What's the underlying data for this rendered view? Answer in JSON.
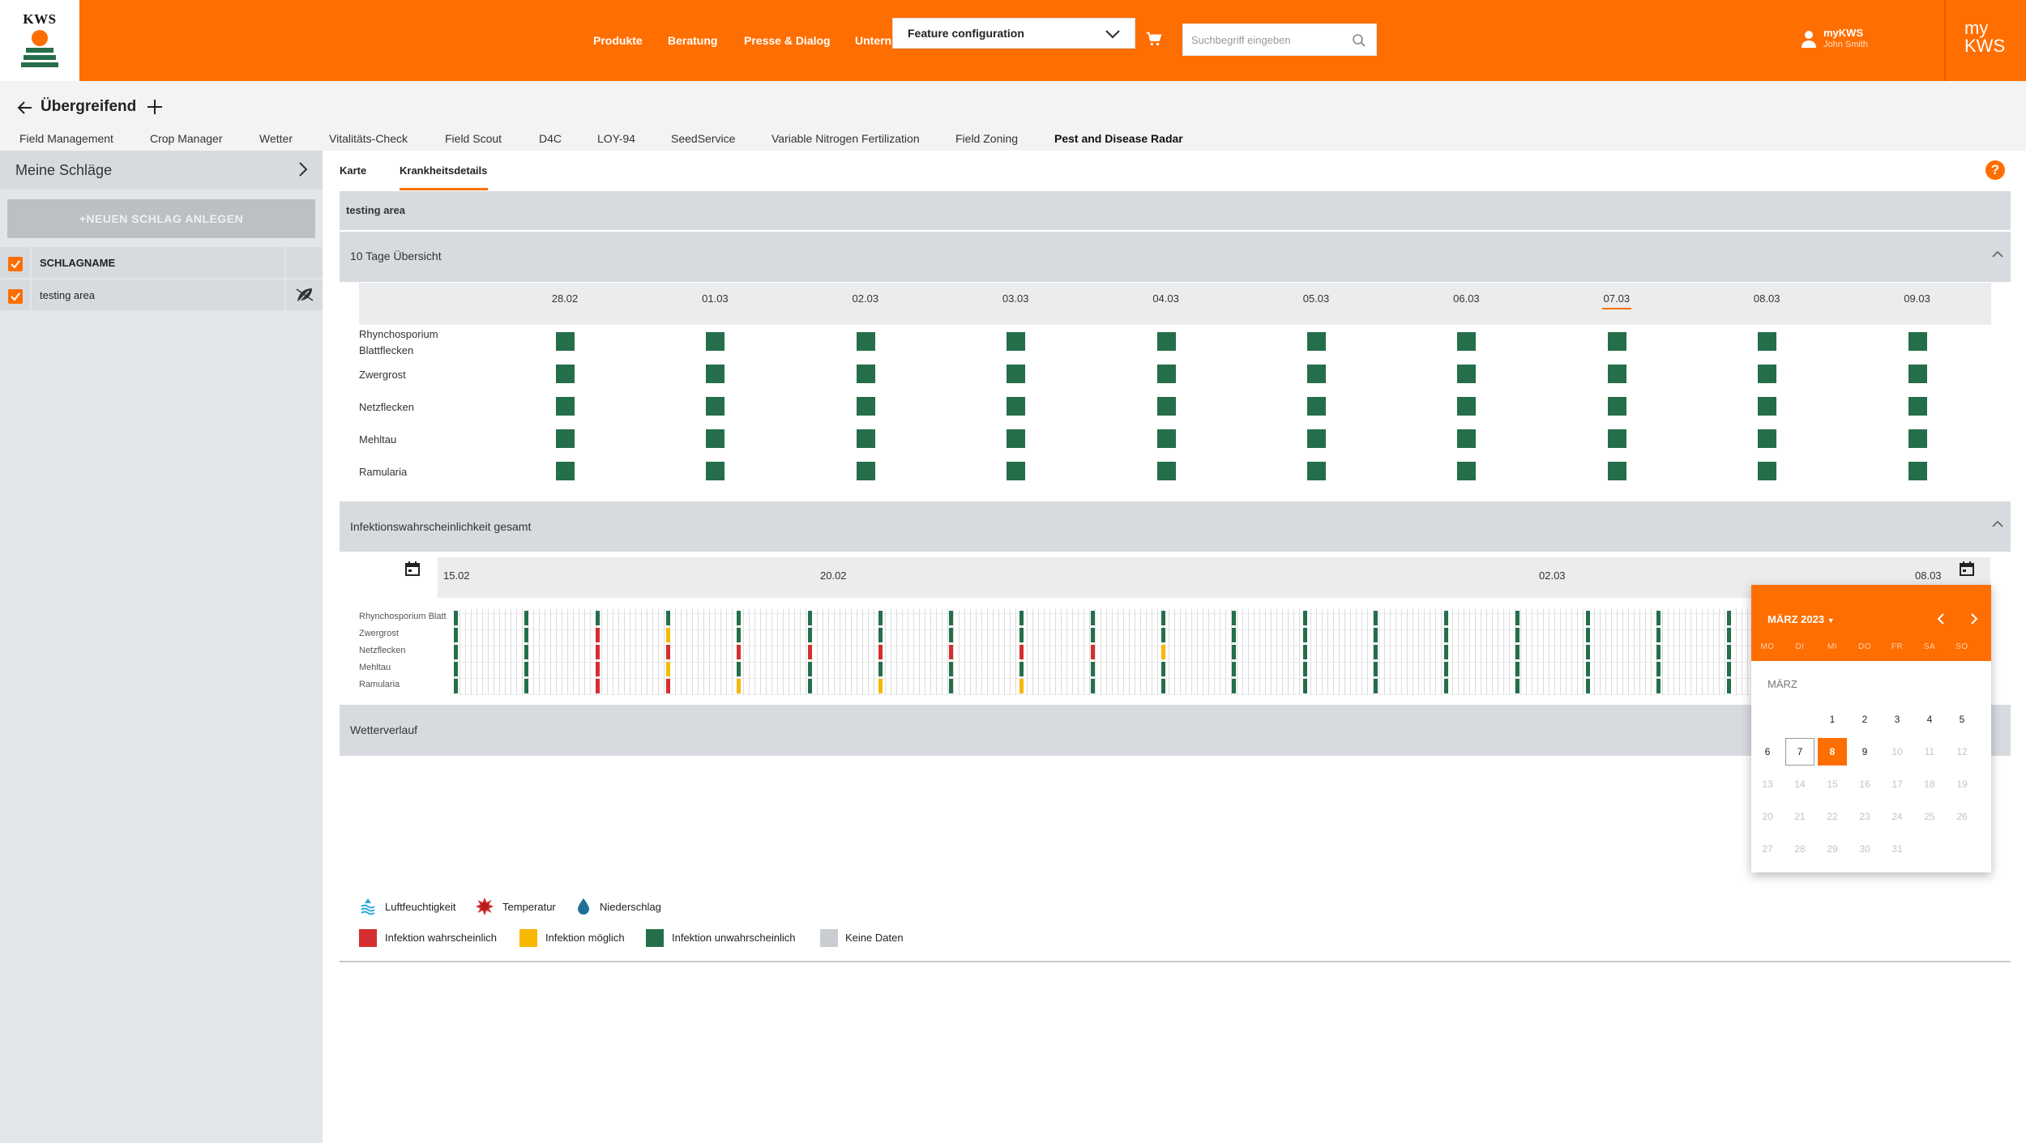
{
  "brand": {
    "logo_text": "KWS",
    "accent": "#ff6e00"
  },
  "header": {
    "nav": [
      "Produkte",
      "Beratung",
      "Presse & Dialog",
      "Untern"
    ],
    "feature_config": "Feature configuration",
    "search_placeholder": "Suchbegriff eingeben",
    "user": {
      "label": "myKWS",
      "name": "John Smith"
    },
    "mykws": {
      "line1": "my",
      "line2": "KWS"
    }
  },
  "subheader": {
    "title": "Übergreifend",
    "tabs": [
      "Field Management",
      "Crop Manager",
      "Wetter",
      "Vitalitäts-Check",
      "Field Scout",
      "D4C",
      "LOY-94",
      "SeedService",
      "Variable Nitrogen Fertilization",
      "Field Zoning",
      "Pest and Disease Radar"
    ],
    "active_tab": "Pest and Disease Radar"
  },
  "sidebar": {
    "title": "Meine Schläge",
    "new_button": "+NEUEN SCHLAG ANLEGEN",
    "column_header": "SCHLAGNAME",
    "rows": [
      {
        "name": "testing area",
        "checked": true
      }
    ]
  },
  "main": {
    "tabs": [
      "Karte",
      "Krankheitsdetails"
    ],
    "active_tab": "Krankheitsdetails",
    "area_title": "testing area",
    "overview": {
      "title": "10 Tage Übersicht",
      "dates": [
        "28.02",
        "01.03",
        "02.03",
        "03.03",
        "04.03",
        "05.03",
        "06.03",
        "07.03",
        "08.03",
        "09.03"
      ],
      "highlight_date": "07.03",
      "diseases": [
        "Rhynchosporium Blattflecken",
        "Zwergrost",
        "Netzflecken",
        "Mehltau",
        "Ramularia"
      ],
      "status": [
        [
          "unlikely",
          "unlikely",
          "unlikely",
          "unlikely",
          "unlikely",
          "unlikely",
          "unlikely",
          "unlikely",
          "unlikely",
          "unlikely"
        ],
        [
          "unlikely",
          "unlikely",
          "unlikely",
          "unlikely",
          "unlikely",
          "unlikely",
          "unlikely",
          "unlikely",
          "unlikely",
          "unlikely"
        ],
        [
          "unlikely",
          "unlikely",
          "unlikely",
          "unlikely",
          "unlikely",
          "unlikely",
          "unlikely",
          "unlikely",
          "unlikely",
          "unlikely"
        ],
        [
          "unlikely",
          "unlikely",
          "unlikely",
          "unlikely",
          "unlikely",
          "unlikely",
          "unlikely",
          "unlikely",
          "unlikely",
          "unlikely"
        ],
        [
          "unlikely",
          "unlikely",
          "unlikely",
          "unlikely",
          "unlikely",
          "unlikely",
          "unlikely",
          "unlikely",
          "unlikely",
          "unlikely"
        ]
      ]
    },
    "infection": {
      "title": "Infektionswahrscheinlichkeit gesamt",
      "timeline_dates": [
        "15.02",
        "20.02",
        "02.03",
        "08.03"
      ],
      "labels": [
        "Rhynchosporium Blatt",
        "Zwergrost",
        "Netzflecken",
        "Mehltau",
        "Ramularia"
      ],
      "columns": [
        [
          "unlikely",
          "unlikely",
          "unlikely",
          "unlikely",
          "unlikely"
        ],
        [
          "unlikely",
          "unlikely",
          "unlikely",
          "unlikely",
          "unlikely"
        ],
        [
          "unlikely",
          "likely",
          "likely",
          "likely",
          "likely"
        ],
        [
          "unlikely",
          "possible",
          "likely",
          "possible",
          "likely"
        ],
        [
          "unlikely",
          "unlikely",
          "likely",
          "unlikely",
          "possible"
        ],
        [
          "unlikely",
          "unlikely",
          "likely",
          "unlikely",
          "unlikely"
        ],
        [
          "unlikely",
          "unlikely",
          "likely",
          "unlikely",
          "possible"
        ],
        [
          "unlikely",
          "unlikely",
          "likely",
          "unlikely",
          "unlikely"
        ],
        [
          "unlikely",
          "unlikely",
          "likely",
          "unlikely",
          "possible"
        ],
        [
          "unlikely",
          "unlikely",
          "likely",
          "unlikely",
          "unlikely"
        ],
        [
          "unlikely",
          "unlikely",
          "possible",
          "unlikely",
          "unlikely"
        ],
        [
          "unlikely",
          "unlikely",
          "unlikely",
          "unlikely",
          "unlikely"
        ],
        [
          "unlikely",
          "unlikely",
          "unlikely",
          "unlikely",
          "unlikely"
        ],
        [
          "unlikely",
          "unlikely",
          "unlikely",
          "unlikely",
          "unlikely"
        ],
        [
          "unlikely",
          "unlikely",
          "unlikely",
          "unlikely",
          "unlikely"
        ],
        [
          "unlikely",
          "unlikely",
          "unlikely",
          "unlikely",
          "unlikely"
        ],
        [
          "unlikely",
          "unlikely",
          "unlikely",
          "unlikely",
          "unlikely"
        ],
        [
          "unlikely",
          "unlikely",
          "unlikely",
          "unlikely",
          "unlikely"
        ],
        [
          "unlikely",
          "unlikely",
          "unlikely",
          "unlikely",
          "unlikely"
        ]
      ]
    },
    "weather_title": "Wetterverlauf",
    "legend_weather": [
      {
        "label": "Luftfeuchtigkeit",
        "icon": "humidity-icon"
      },
      {
        "label": "Temperatur",
        "icon": "temperature-icon"
      },
      {
        "label": "Niederschlag",
        "icon": "precipitation-icon"
      }
    ],
    "legend_status": [
      {
        "label": "Infektion wahrscheinlich",
        "color": "#d32f2f"
      },
      {
        "label": "Infektion möglich",
        "color": "#f6b800"
      },
      {
        "label": "Infektion unwahrscheinlich",
        "color": "#256e4a"
      },
      {
        "label": "Keine Daten",
        "color": "#c9ccd0"
      }
    ],
    "status_colors": {
      "unlikely": "#256e4a",
      "possible": "#f6b800",
      "likely": "#d32f2f"
    }
  },
  "datepicker": {
    "month_label": "MÄRZ 2023",
    "weekdays": [
      "MO",
      "DI",
      "MI",
      "DO",
      "FR",
      "SA",
      "SO"
    ],
    "month_name": "MÄRZ",
    "first_weekday_index": 2,
    "days_in_month": 31,
    "today": 7,
    "selected": 8,
    "last_enabled": 9
  }
}
